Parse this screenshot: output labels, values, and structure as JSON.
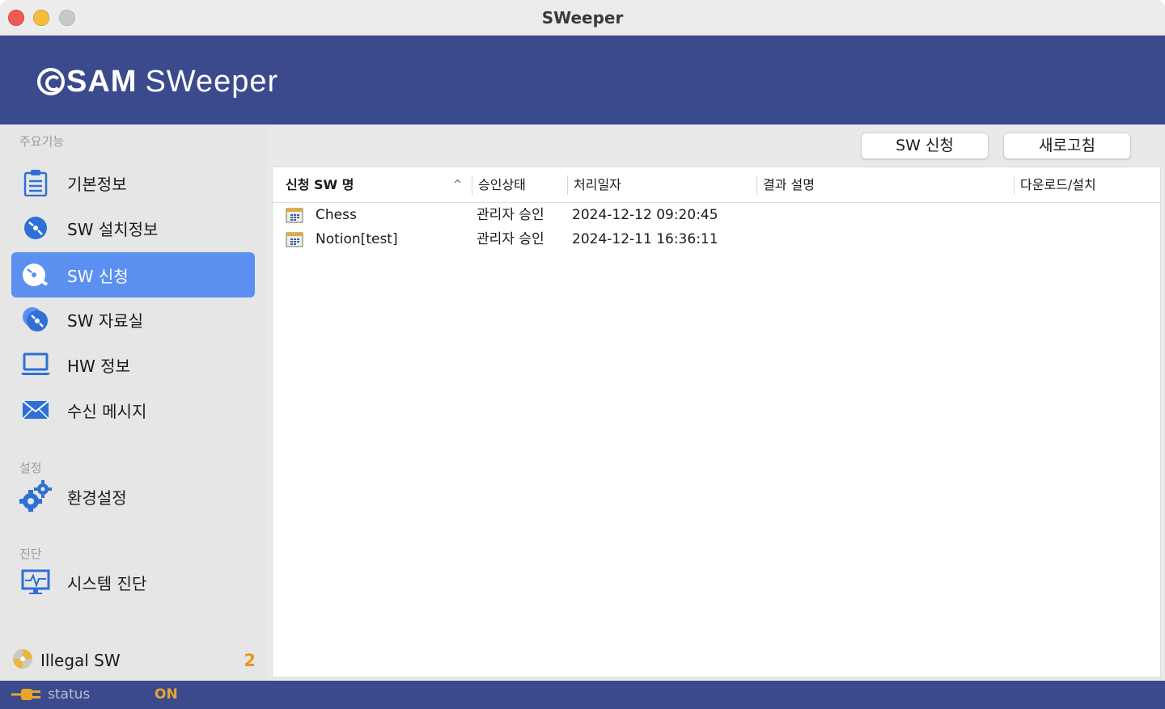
{
  "window": {
    "title": "SWeeper"
  },
  "header": {
    "logo_sam": "SAM",
    "logo_product": "SWeeper"
  },
  "sidebar": {
    "section_main": "주요기능",
    "section_settings": "설정",
    "section_diagnosis": "진단",
    "items": [
      {
        "label": "기본정보",
        "icon": "clipboard-icon"
      },
      {
        "label": "SW 설치정보",
        "icon": "disc-icon"
      },
      {
        "label": "SW 신청",
        "icon": "disc-request-icon",
        "active": true
      },
      {
        "label": "SW 자료실",
        "icon": "disc-stack-icon"
      },
      {
        "label": "HW 정보",
        "icon": "laptop-icon"
      },
      {
        "label": "수신 메시지",
        "icon": "envelope-icon"
      },
      {
        "label": "환경설정",
        "icon": "gears-icon"
      },
      {
        "label": "시스템 진단",
        "icon": "monitor-pulse-icon"
      }
    ],
    "illegal": {
      "label": "Illegal SW",
      "count": "2"
    }
  },
  "toolbar": {
    "sw_request_label": "SW 신청",
    "refresh_label": "새로고침"
  },
  "table": {
    "columns": [
      "신청 SW 명",
      "승인상태",
      "처리일자",
      "결과 설명",
      "다운로드/설치"
    ],
    "rows": [
      {
        "name": "Chess",
        "status": "관리자 승인",
        "date": "2024-12-12 09:20:45",
        "result": "",
        "download": ""
      },
      {
        "name": "Notion[test]",
        "status": "관리자 승인",
        "date": "2024-12-11 16:36:11",
        "result": "",
        "download": ""
      }
    ]
  },
  "statusbar": {
    "label": "status",
    "value": "ON"
  },
  "colors": {
    "brand": "#3b4a8c",
    "active": "#5b8ff0",
    "icon_blue": "#2f6fd6",
    "warning": "#e8961a"
  }
}
